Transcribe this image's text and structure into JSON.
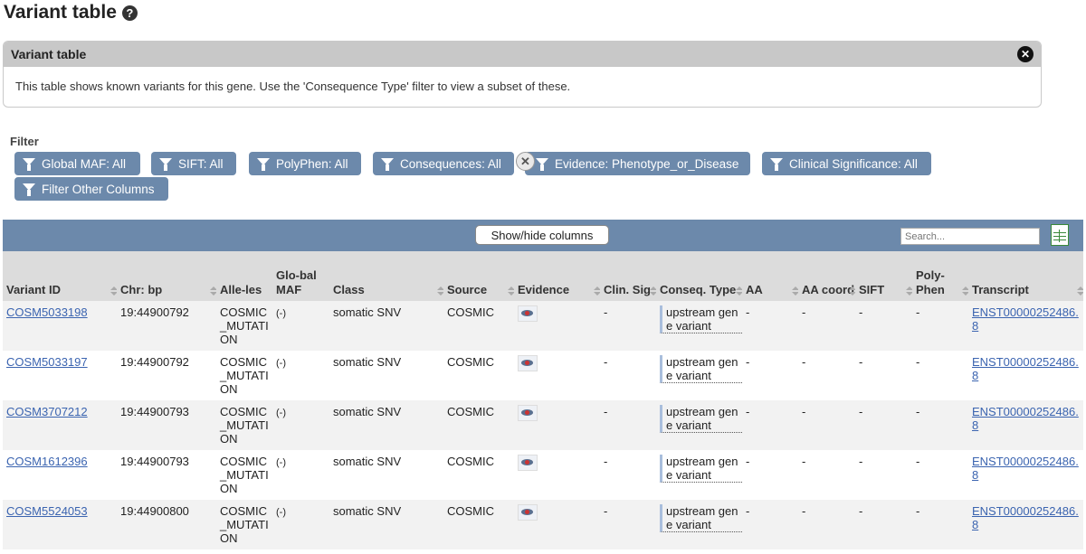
{
  "page": {
    "title": "Variant table",
    "help_icon": "help-icon"
  },
  "panel": {
    "title": "Variant table",
    "description": "This table shows known variants for this gene. Use the 'Consequence Type' filter to view a subset of these."
  },
  "filters": {
    "label": "Filter",
    "buttons": [
      "Global MAF: All",
      "SIFT: All",
      "PolyPhen: All",
      "Consequences: All",
      "Evidence: Phenotype_or_Disease",
      "Clinical Significance: All",
      "Filter Other Columns"
    ]
  },
  "table_toolbar": {
    "show_hide_label": "Show/hide columns",
    "search_placeholder": "Search..."
  },
  "columns": [
    "Variant ID",
    "Chr: bp",
    "Alle-les",
    "Glo-bal MAF",
    "Class",
    "Source",
    "Evidence",
    "Clin. Sig.",
    "Conseq. Type",
    "AA",
    "AA coord",
    "SIFT",
    "Poly-Phen",
    "Transcript"
  ],
  "rows": [
    {
      "id": "COSM5033198",
      "chr": "19:44900792",
      "alleles": "COSMIC_MUTATION",
      "maf": "(-)",
      "class": "somatic SNV",
      "source": "COSMIC",
      "clin": "-",
      "conseq": "upstream gene variant",
      "aa": "-",
      "aa_coord": "-",
      "sift": "-",
      "polyphen": "-",
      "transcript": "ENST00000252486.8"
    },
    {
      "id": "COSM5033197",
      "chr": "19:44900792",
      "alleles": "COSMIC_MUTATION",
      "maf": "(-)",
      "class": "somatic SNV",
      "source": "COSMIC",
      "clin": "-",
      "conseq": "upstream gene variant",
      "aa": "-",
      "aa_coord": "-",
      "sift": "-",
      "polyphen": "-",
      "transcript": "ENST00000252486.8"
    },
    {
      "id": "COSM3707212",
      "chr": "19:44900793",
      "alleles": "COSMIC_MUTATION",
      "maf": "(-)",
      "class": "somatic SNV",
      "source": "COSMIC",
      "clin": "-",
      "conseq": "upstream gene variant",
      "aa": "-",
      "aa_coord": "-",
      "sift": "-",
      "polyphen": "-",
      "transcript": "ENST00000252486.8"
    },
    {
      "id": "COSM1612396",
      "chr": "19:44900793",
      "alleles": "COSMIC_MUTATION",
      "maf": "(-)",
      "class": "somatic SNV",
      "source": "COSMIC",
      "clin": "-",
      "conseq": "upstream gene variant",
      "aa": "-",
      "aa_coord": "-",
      "sift": "-",
      "polyphen": "-",
      "transcript": "ENST00000252486.8"
    },
    {
      "id": "COSM5524053",
      "chr": "19:44900800",
      "alleles": "COSMIC_MUTATION",
      "maf": "(-)",
      "class": "somatic SNV",
      "source": "COSMIC",
      "clin": "-",
      "conseq": "upstream gene variant",
      "aa": "-",
      "aa_coord": "-",
      "sift": "-",
      "polyphen": "-",
      "transcript": "ENST00000252486.8"
    }
  ]
}
